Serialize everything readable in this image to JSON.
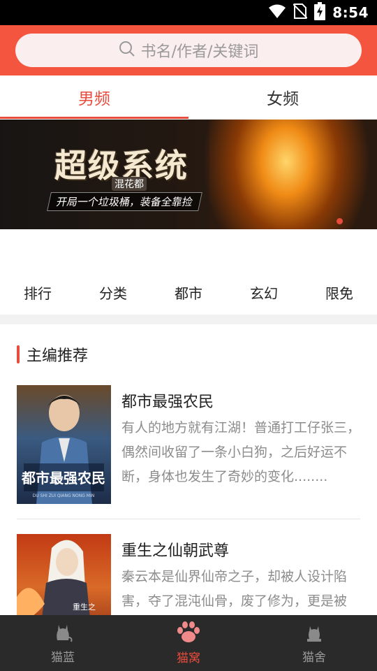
{
  "status_bar": {
    "time": "8:54",
    "icons": [
      "wifi-icon",
      "no-sim-icon",
      "battery-charging-icon"
    ]
  },
  "search": {
    "placeholder": "书名/作者/关键词"
  },
  "gender_tabs": [
    {
      "label": "男频",
      "active": true
    },
    {
      "label": "女频",
      "active": false
    }
  ],
  "banner": {
    "title": "超级系统",
    "subtitle": "混花都",
    "slogan": "开局一个垃圾桶，装备全靠捡"
  },
  "categories": [
    "排行",
    "分类",
    "都市",
    "玄幻",
    "限免"
  ],
  "section": {
    "title": "主编推荐"
  },
  "books": [
    {
      "title": "都市最强农民",
      "description": "有人的地方就有江湖！普通打工仔张三，偶然间收留了一条小白狗，之后好运不断，身体也发生了奇妙的变化........",
      "cover_text": "都市最强农民",
      "cover_pinyin": "DU SHI ZUI QIANG NONG MIN"
    },
    {
      "title": "重生之仙朝武尊",
      "description": "秦云本是仙界仙帝之子，却被人设计陷害，夺了混沌仙骨，废了修为，更是被",
      "cover_text": "重生之"
    }
  ],
  "bottom_nav": [
    {
      "label": "猫蓝",
      "icon": "cat-icon",
      "active": false
    },
    {
      "label": "猫窝",
      "icon": "paw-icon",
      "active": true
    },
    {
      "label": "猫舍",
      "icon": "cat-house-icon",
      "active": false
    }
  ],
  "colors": {
    "accent": "#e84c3d",
    "header": "#f4553f",
    "nav_bg": "#2a2a2a"
  }
}
